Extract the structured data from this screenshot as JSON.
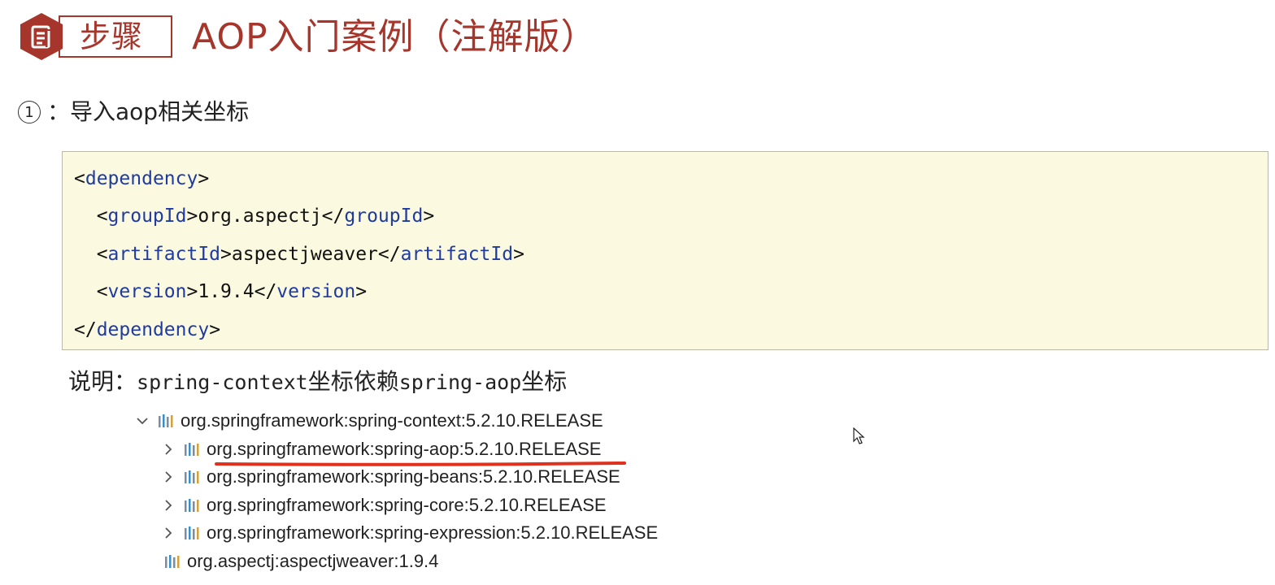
{
  "header": {
    "badge_text": "步骤",
    "badge_icon": "document-icon",
    "title": "AOP入门案例（注解版）"
  },
  "step": {
    "number": "①",
    "text": "：导入aop相关坐标"
  },
  "code": {
    "lines": [
      {
        "open": "<",
        "tag": "dependency",
        "close": ">",
        "value": "",
        "endopen": "",
        "endtag": "",
        "endclose": ""
      },
      {
        "open": "  <",
        "tag": "groupId",
        "close": ">",
        "value": "org.aspectj",
        "endopen": "</",
        "endtag": "groupId",
        "endclose": ">"
      },
      {
        "open": "  <",
        "tag": "artifactId",
        "close": ">",
        "value": "aspectjweaver",
        "endopen": "</",
        "endtag": "artifactId",
        "endclose": ">"
      },
      {
        "open": "  <",
        "tag": "version",
        "close": ">",
        "value": "1.9.4",
        "endopen": "</",
        "endtag": "version",
        "endclose": ">"
      },
      {
        "open": "</",
        "tag": "dependency",
        "close": ">",
        "value": "",
        "endopen": "",
        "endtag": "",
        "endclose": ""
      }
    ],
    "colors": {
      "background": "#fbfae0",
      "tag": "#1f3aa1"
    }
  },
  "note": {
    "prefix": "说明：",
    "mono_1": "spring-context",
    "mid": "坐标依赖",
    "mono_2": "spring-aop",
    "suffix": "坐标"
  },
  "tree": {
    "items": [
      {
        "label": "org.springframework:spring-context:5.2.10.RELEASE",
        "expanded": true,
        "has_chevron": true
      },
      {
        "label": "org.springframework:spring-aop:5.2.10.RELEASE",
        "expanded": false,
        "has_chevron": true,
        "highlighted": true
      },
      {
        "label": "org.springframework:spring-beans:5.2.10.RELEASE",
        "expanded": false,
        "has_chevron": true
      },
      {
        "label": "org.springframework:spring-core:5.2.10.RELEASE",
        "expanded": false,
        "has_chevron": true
      },
      {
        "label": "org.springframework:spring-expression:5.2.10.RELEASE",
        "expanded": false,
        "has_chevron": true
      },
      {
        "label": "org.aspectj:aspectjweaver:1.9.4",
        "expanded": false,
        "has_chevron": false
      }
    ],
    "icon": "library-icon",
    "highlight_color": "#e0301e"
  },
  "theme": {
    "accent": "#a6352b"
  }
}
